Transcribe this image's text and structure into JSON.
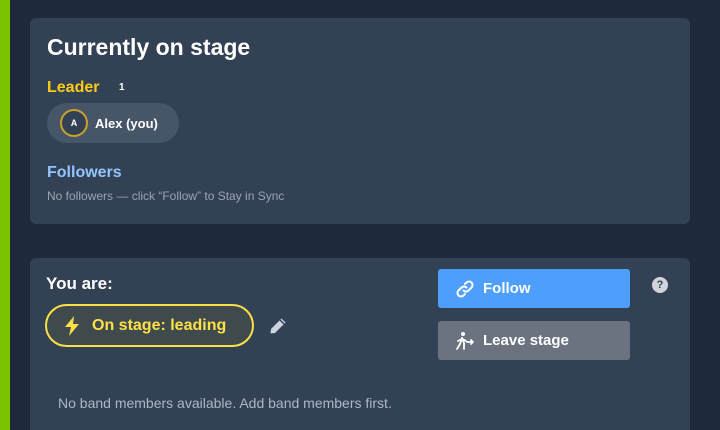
{
  "colors": {
    "accent_bar": "#7cc400",
    "leader": "#facc15",
    "followers": "#93c5fd",
    "follow_button": "#4d9ffb",
    "leave_button": "#6b7280",
    "status": "#fde047"
  },
  "stage": {
    "title": "Currently on stage",
    "leader_label": "Leader",
    "leader_count": "1",
    "leader": {
      "initial": "A",
      "name": "Alex (you)"
    },
    "followers_label": "Followers",
    "followers_empty": "No followers — click “Follow” to Stay in Sync"
  },
  "you": {
    "label": "You are:",
    "status": "On stage: leading",
    "status_icon": "bolt-icon",
    "edit_icon": "pencil-icon",
    "follow_label": "Follow",
    "follow_icon": "link-icon",
    "leave_label": "Leave stage",
    "leave_icon": "exit-person-icon",
    "help_glyph": "?",
    "no_members": "No band members available. Add band members first."
  }
}
